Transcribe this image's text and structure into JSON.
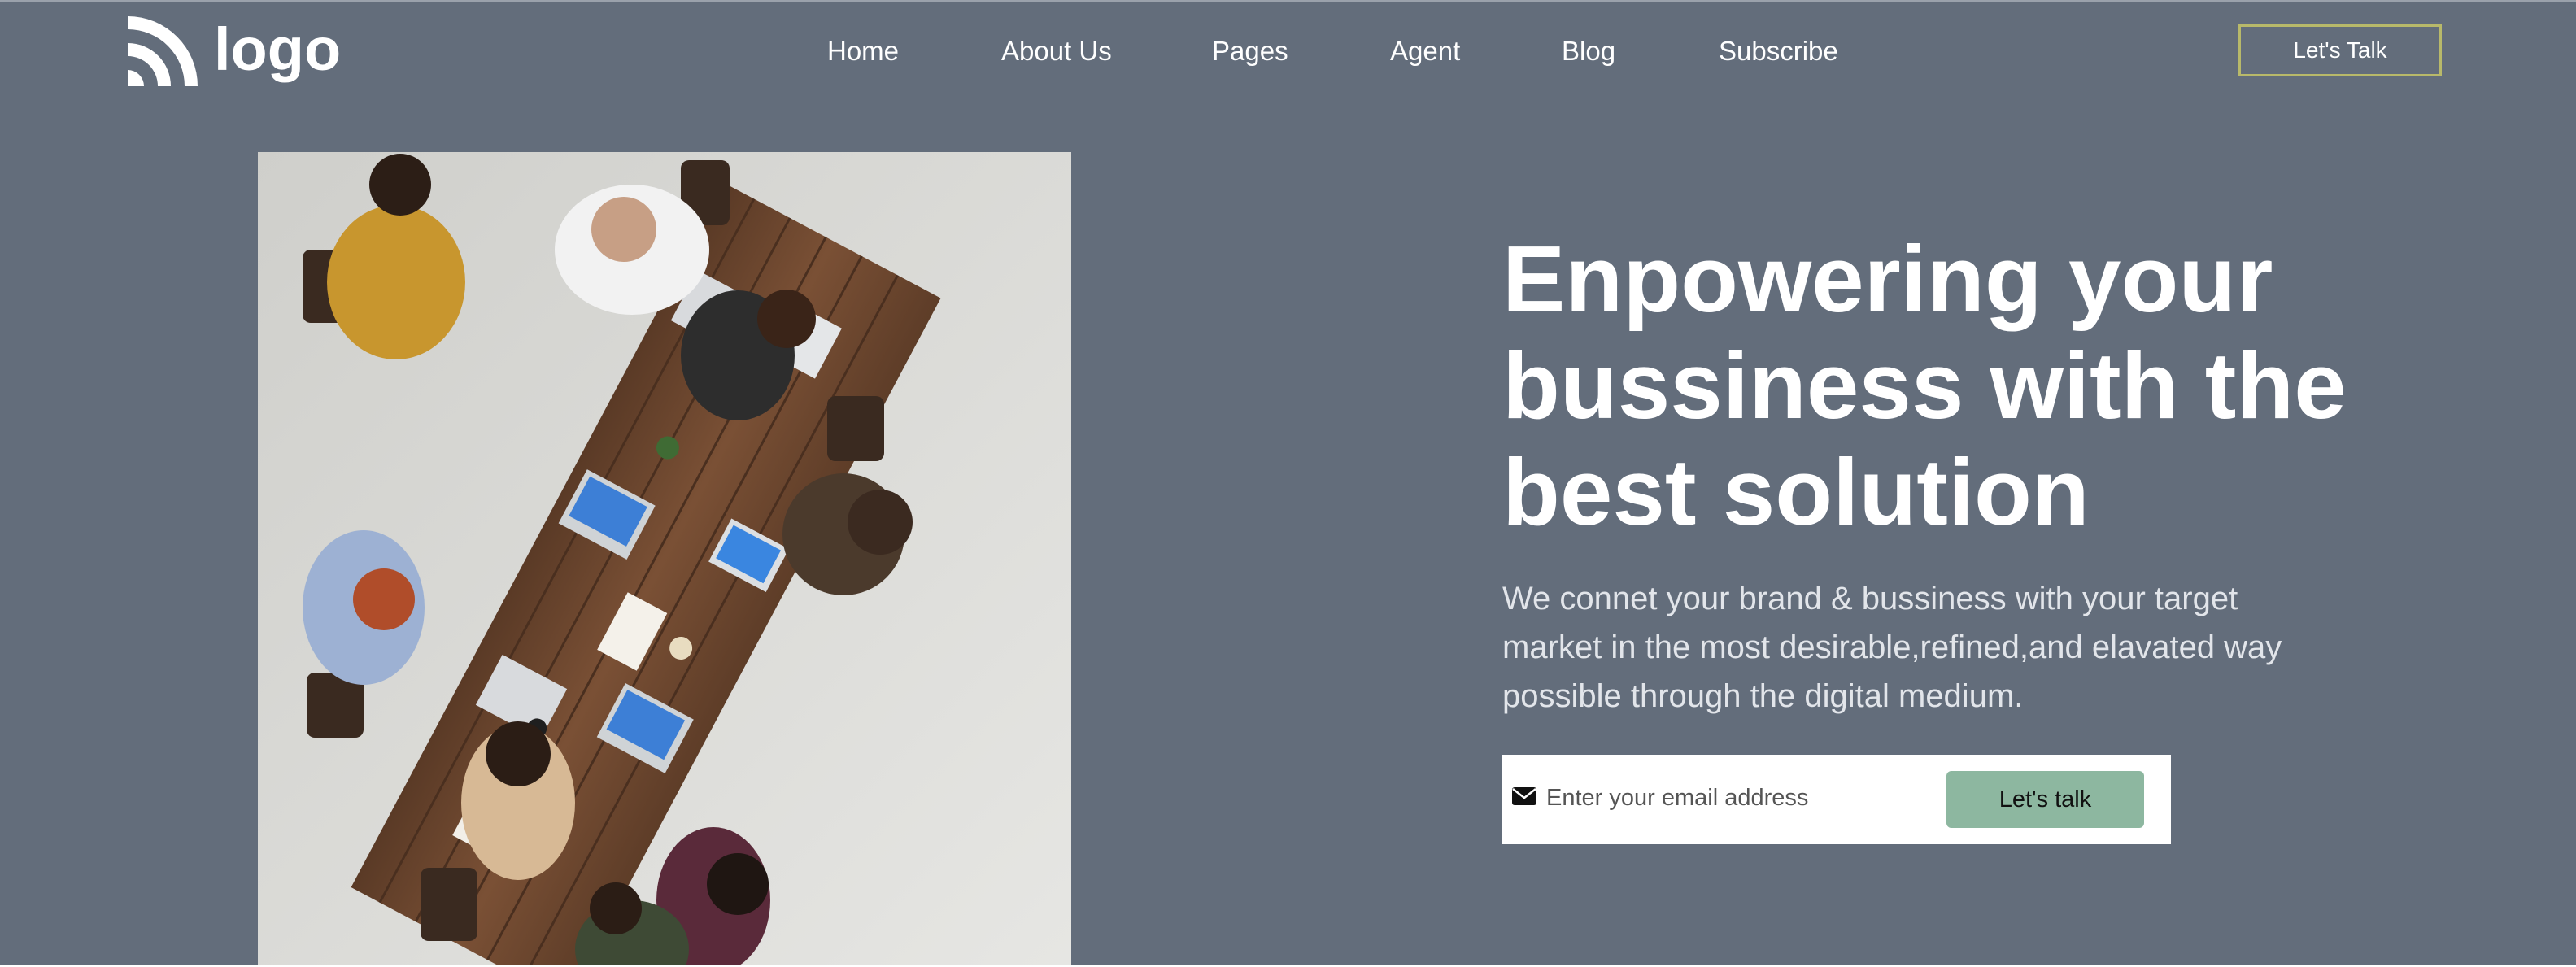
{
  "header": {
    "logo_text": "logo",
    "nav": [
      "Home",
      "About Us",
      "Pages",
      "Agent",
      "Blog",
      "Subscribe"
    ],
    "cta_label": "Let's Talk"
  },
  "hero": {
    "headline": "Enpowering your bussiness with the best solution",
    "subtext": "We connet your brand & bussiness with your target market in the most desirable,refined,and elavated way possible through the digital medium.",
    "email_placeholder": "Enter your email address",
    "signup_label": "Let's talk"
  },
  "colors": {
    "background": "#636d7b",
    "button": "#8db7a0",
    "cta_border": "#b8b96a"
  },
  "icons": [
    "logo-arcs-icon",
    "envelope-icon"
  ]
}
